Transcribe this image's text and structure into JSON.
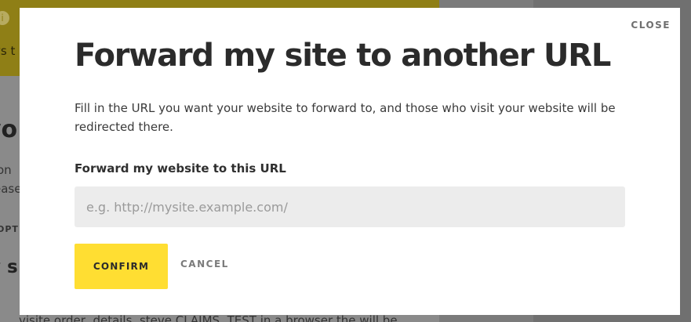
{
  "background": {
    "banner_text": "ys t",
    "heading": "yo",
    "line1": "on",
    "line2": "ease",
    "small_label": "OPT",
    "heading2": "y s",
    "bottom_text": "visite order, details, steve CLAIMS, TEST in a browser the will be"
  },
  "modal": {
    "close_label": "CLOSE",
    "title": "Forward my site to another URL",
    "description": "Fill in the URL you want your website to forward to, and those who visit your website will be redirected there.",
    "field_label": "Forward my website to this URL",
    "input": {
      "value": "",
      "placeholder": "e.g. http://mysite.example.com/"
    },
    "confirm_label": "CONFIRM",
    "cancel_label": "CANCEL"
  },
  "colors": {
    "accent": "#ffde32",
    "overlay": "#6e6e6e",
    "input_bg": "#ececec"
  }
}
